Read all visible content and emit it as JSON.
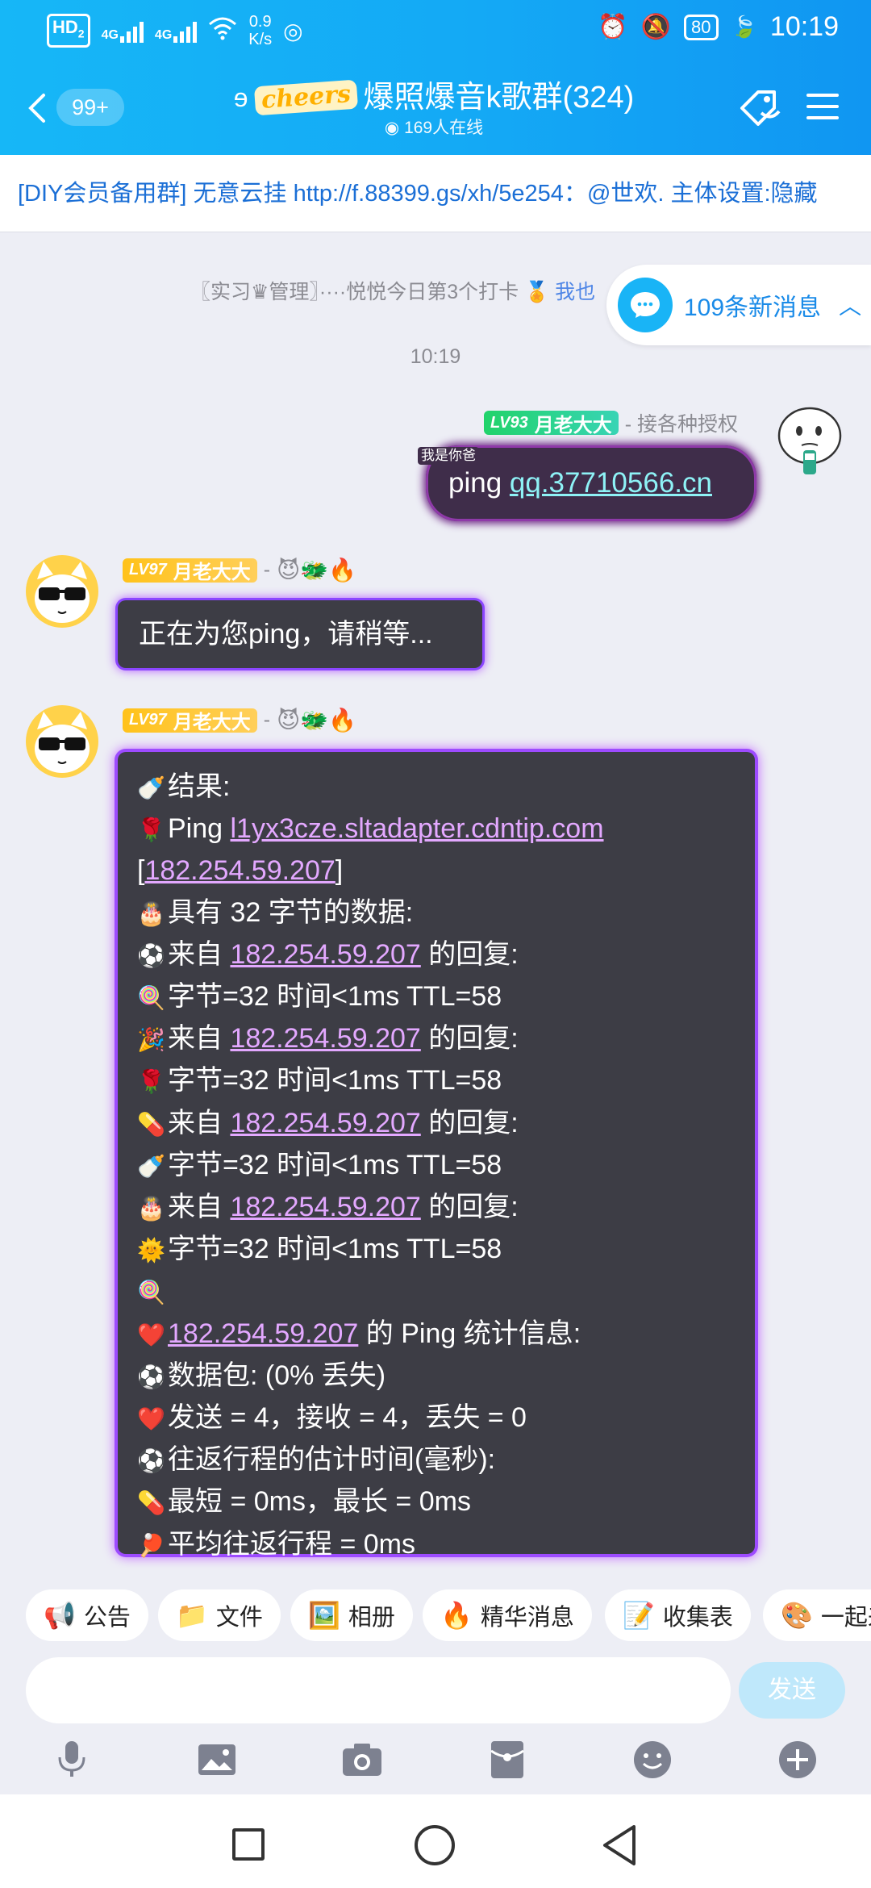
{
  "status_bar": {
    "hd_label": "HD",
    "hd_sub": "2",
    "net1": "4G",
    "net2": "4G",
    "speed_value": "0.9",
    "speed_unit": "K/s",
    "battery": "80",
    "time": "10:19"
  },
  "header": {
    "back_badge": "99+",
    "cheers_logo": "cheers",
    "group_title": "爆照爆音k歌群(324)",
    "online_count": "169人在线"
  },
  "announcement": {
    "text": "[DIY会员备用群] 无意云挂 http://f.88399.gs/xh/5e254：@世欢. 主体设置:隐藏"
  },
  "chat": {
    "notice_text": "〖实习♛管理〗····悦悦今日第3个打卡",
    "notice_link": "我也",
    "new_messages": "109条新消息",
    "timestamp": "10:19",
    "messages": [
      {
        "lv": "LV93",
        "name": "月老大大",
        "suffix": "- 接各种授权",
        "tag": "我是你爸",
        "text_prefix": "ping ",
        "link": "qq.37710566.cn"
      },
      {
        "lv": "LV97",
        "name": "月老大大",
        "suffix": "-",
        "emojis": "😈🐲🔥",
        "text": "正在为您ping，请稍等..."
      },
      {
        "lv": "LV97",
        "name": "月老大大",
        "suffix": "-",
        "emojis": "😈🐲🔥",
        "lines": [
          {
            "icon": "🍼",
            "pre": "结果:",
            "link": "",
            "post": ""
          },
          {
            "icon": "🌹",
            "pre": "Ping ",
            "link": "l1yx3cze.sltadapter.cdntip.com",
            "post": ""
          },
          {
            "icon": "",
            "pre": "[",
            "link": "182.254.59.207",
            "post": "]"
          },
          {
            "icon": "🎂",
            "pre": "具有 32 字节的数据:",
            "link": "",
            "post": ""
          },
          {
            "icon": "⚽",
            "pre": "来自 ",
            "link": "182.254.59.207",
            "post": " 的回复:"
          },
          {
            "icon": "🍭",
            "pre": "字节=32 时间<1ms TTL=58",
            "link": "",
            "post": ""
          },
          {
            "icon": "🎉",
            "pre": "来自 ",
            "link": "182.254.59.207",
            "post": " 的回复:"
          },
          {
            "icon": "🌹",
            "pre": "字节=32 时间<1ms TTL=58",
            "link": "",
            "post": ""
          },
          {
            "icon": "💊",
            "pre": "来自 ",
            "link": "182.254.59.207",
            "post": " 的回复:"
          },
          {
            "icon": "🍼",
            "pre": "字节=32 时间<1ms TTL=58",
            "link": "",
            "post": ""
          },
          {
            "icon": "🎂",
            "pre": "来自 ",
            "link": "182.254.59.207",
            "post": " 的回复:"
          },
          {
            "icon": "🌞",
            "pre": "字节=32 时间<1ms TTL=58",
            "link": "",
            "post": ""
          },
          {
            "icon": "🍭",
            "pre": "",
            "link": "",
            "post": ""
          },
          {
            "icon": "❤️",
            "pre": "",
            "link": "182.254.59.207",
            "post": " 的 Ping 统计信息:"
          },
          {
            "icon": "⚽",
            "pre": "数据包: (0% 丢失)",
            "link": "",
            "post": ""
          },
          {
            "icon": "❤️",
            "pre": "发送 = 4，接收 = 4，丢失 = 0",
            "link": "",
            "post": ""
          },
          {
            "icon": "⚽",
            "pre": "往返行程的估计时间(毫秒):",
            "link": "",
            "post": ""
          },
          {
            "icon": "💊",
            "pre": "最短 = 0ms，最长 = 0ms",
            "link": "",
            "post": ""
          },
          {
            "icon": "🏓",
            "pre": "平均往返行程 = 0ms",
            "link": "",
            "post": ""
          }
        ]
      }
    ]
  },
  "toolbar": {
    "chips": [
      {
        "icon": "📢",
        "label": "公告"
      },
      {
        "icon": "📁",
        "label": "文件"
      },
      {
        "icon": "🖼️",
        "label": "相册"
      },
      {
        "icon": "🔥",
        "label": "精华消息"
      },
      {
        "icon": "📝",
        "label": "收集表"
      },
      {
        "icon": "🎨",
        "label": "一起来"
      }
    ]
  },
  "input": {
    "send_label": "发送"
  },
  "colors": {
    "header_blue": "#16b7f7",
    "link_purple": "#e3a8ff",
    "bubble_dark": "#3d3d45",
    "accent_blue": "#1a8be8"
  }
}
